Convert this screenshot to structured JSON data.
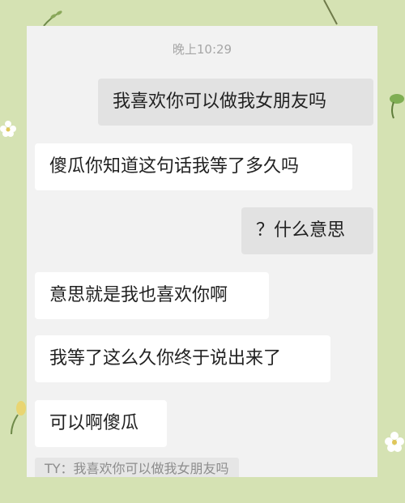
{
  "chat": {
    "timestamp": "晚上10:29",
    "messages": [
      {
        "side": "right",
        "text": "我喜欢你可以做我女朋友吗"
      },
      {
        "side": "left",
        "text": "傻瓜你知道这句话我等了多久吗"
      },
      {
        "side": "right",
        "text": "？什么意思"
      },
      {
        "side": "left",
        "text": "意思就是我也喜欢你啊"
      },
      {
        "side": "left",
        "text": "我等了这么久你终于说出来了"
      },
      {
        "side": "left",
        "text": "可以啊傻瓜"
      }
    ],
    "quote": "TY：我喜欢你可以做我女朋友吗"
  },
  "colors": {
    "background": "#d5e2b3",
    "panel": "#f2f2f2",
    "bubble_received": "#ffffff",
    "bubble_sent": "#e2e2e2"
  },
  "decorations": [
    "sprout-icon",
    "flower-icon",
    "leaf-icon",
    "stick-icon"
  ]
}
